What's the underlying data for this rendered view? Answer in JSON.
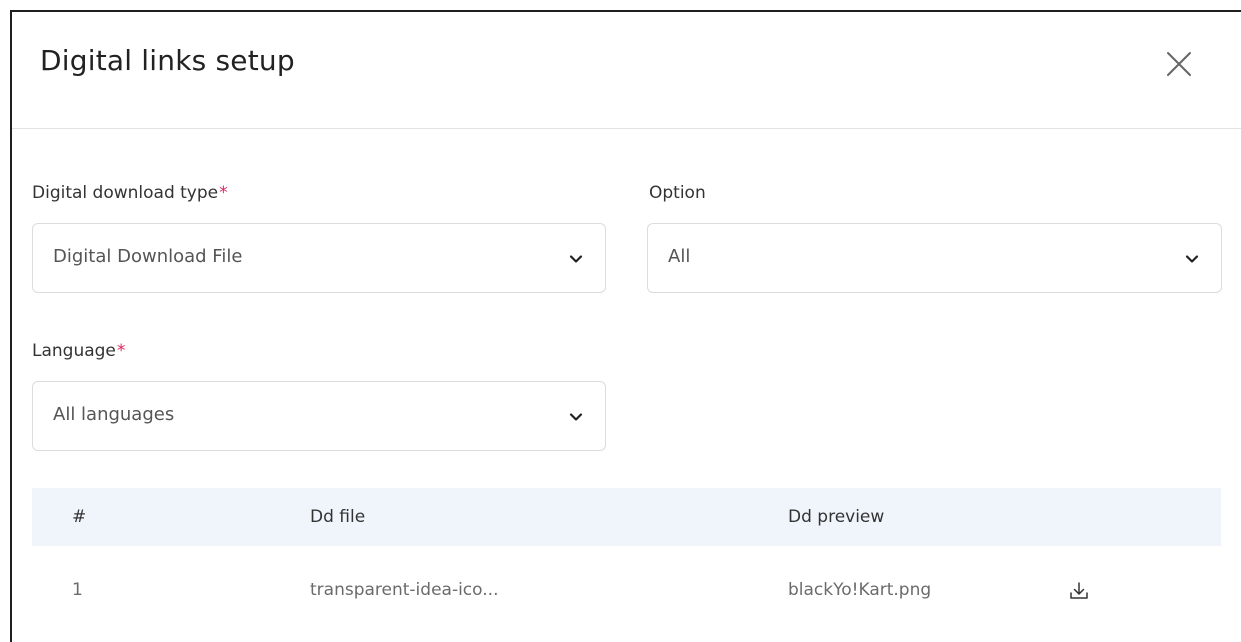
{
  "modal": {
    "title": "Digital links setup"
  },
  "form": {
    "download_type": {
      "label": "Digital download type",
      "required_mark": "*",
      "value": "Digital Download File"
    },
    "option": {
      "label": "Option",
      "value": "All"
    },
    "language": {
      "label": "Language",
      "required_mark": "*",
      "value": "All languages"
    }
  },
  "table": {
    "headers": [
      "#",
      "Dd file",
      "Dd preview"
    ],
    "rows": [
      {
        "index": "1",
        "file": "transparent-idea-ico...",
        "preview": "blackYo!Kart.png"
      }
    ]
  },
  "icons": {
    "close": "close-icon",
    "chevron": "chevron-down-icon",
    "download": "download-icon"
  },
  "colors": {
    "required": "#e0245e",
    "table_header_bg": "#f0f5fc",
    "border": "#dcdcdc"
  }
}
